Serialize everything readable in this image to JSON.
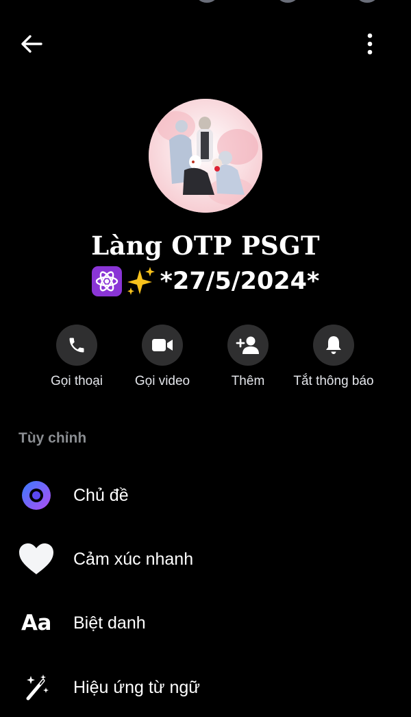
{
  "header": {
    "back_icon": "arrow-left-icon",
    "more_icon": "vertical-dots-icon"
  },
  "profile": {
    "name": "Làng OTP PSGT",
    "emoji_1": "atom-symbol-emoji",
    "emoji_2": "sparkles-emoji",
    "date_text": "*27/5/2024*"
  },
  "actions": [
    {
      "label": "Gọi thoại",
      "icon": "phone-icon"
    },
    {
      "label": "Gọi video",
      "icon": "video-camera-icon"
    },
    {
      "label": "Thêm",
      "icon": "add-person-icon"
    },
    {
      "label": "Tắt thông báo",
      "icon": "bell-icon"
    }
  ],
  "customize": {
    "section_title": "Tùy chỉnh",
    "items": [
      {
        "label": "Chủ đề",
        "icon": "theme-circle-icon"
      },
      {
        "label": "Cảm xúc nhanh",
        "icon": "white-heart-icon"
      },
      {
        "label": "Biệt danh",
        "icon": "aa-text-icon",
        "icon_text": "Aa"
      },
      {
        "label": "Hiệu ứng từ ngữ",
        "icon": "magic-wand-icon"
      }
    ]
  },
  "colors": {
    "background": "#000000",
    "button_circle": "#2f2f30",
    "section_title": "#8a8d91",
    "theme_gradient_start": "#3a7bff",
    "theme_gradient_end": "#b04ef2"
  }
}
